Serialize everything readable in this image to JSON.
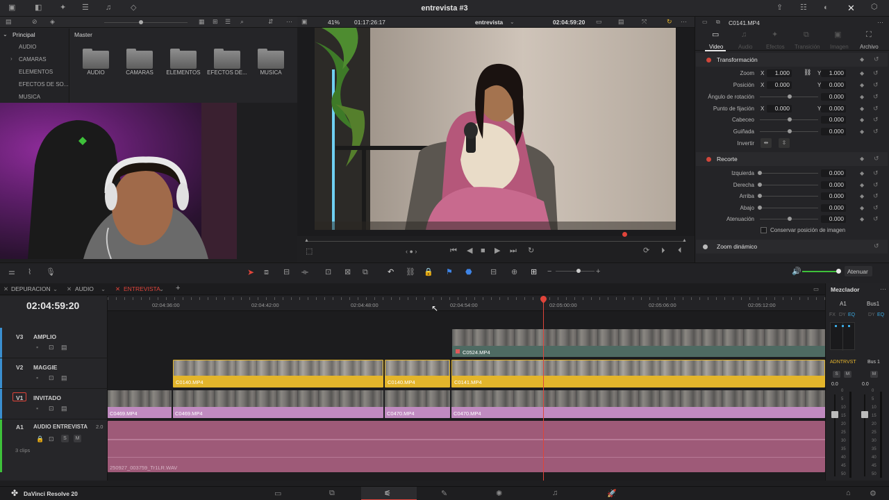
{
  "app": {
    "name": "DaVinci Resolve 20",
    "project_title": "entrevista #3"
  },
  "media_pool": {
    "principal_label": "Principal",
    "master_label": "Master",
    "bins": [
      "AUDIO",
      "CAMARAS",
      "ELEMENTOS",
      "EFECTOS DE SO...",
      "MUSICA"
    ],
    "folders": [
      "AUDIO",
      "CAMARAS",
      "ELEMENTOS",
      "EFECTOS DE...",
      "MUSICA"
    ]
  },
  "viewer": {
    "zoom": "41%",
    "source_timecode": "01:17:26:17",
    "timeline_name": "entrevista",
    "current_timecode": "02:04:59:20"
  },
  "inspector": {
    "clip_name": "C0141.MP4",
    "tabs": [
      "Video",
      "Audio",
      "Efectos",
      "Transición",
      "Imagen",
      "Archivo"
    ],
    "active_tab": "Video",
    "transform_title": "Transformación",
    "zoom_label": "Zoom",
    "zoom_x": "1.000",
    "zoom_y": "1.000",
    "position_label": "Posición",
    "position_x": "0.000",
    "position_y": "0.000",
    "rotation_label": "Ángulo de rotación",
    "rotation": "0.000",
    "anchor_label": "Punto de fijación",
    "anchor_x": "0.000",
    "anchor_y": "0.000",
    "pitch_label": "Cabeceo",
    "pitch": "0.000",
    "yaw_label": "Guiñada",
    "yaw": "0.000",
    "flip_label": "Invertir",
    "crop_title": "Recorte",
    "crop_left_label": "Izquierda",
    "crop_left": "0.000",
    "crop_right_label": "Derecha",
    "crop_right": "0.000",
    "crop_top_label": "Arriba",
    "crop_top": "0.000",
    "crop_bottom_label": "Abajo",
    "crop_bottom": "0.000",
    "softness_label": "Atenuación",
    "softness": "0.000",
    "retain_label": "Conservar posición de imagen",
    "dynamic_zoom_title": "Zoom dinámico",
    "x_label": "X",
    "y_label": "Y"
  },
  "toolbar": {
    "dim_label": "Atenuar"
  },
  "timeline": {
    "tabs": [
      "DEPURACION",
      "AUDIO",
      "ENTREVISTA"
    ],
    "active_tab": "ENTREVISTA",
    "timecode": "02:04:59:20",
    "ruler_labels": [
      "02:04:36:00",
      "02:04:42:00",
      "02:04:48:00",
      "02:04:54:00",
      "02:05:00:00",
      "02:05:06:00",
      "02:05:12:00"
    ],
    "tracks": {
      "v3": {
        "id": "V3",
        "name": "AMPLIO"
      },
      "v2": {
        "id": "V2",
        "name": "MAGGIE"
      },
      "v1": {
        "id": "V1",
        "name": "INVITADO"
      },
      "a1": {
        "id": "A1",
        "name": "AUDIO ENTREVISTA",
        "level": "2.0",
        "clip_count": "3 clips"
      }
    },
    "clips": {
      "v3_1": "C0524.MP4",
      "v2_1": "C0140.MP4",
      "v2_2": "C0140.MP4",
      "v2_3": "C0141.MP4",
      "v1_1": "C0469.MP4",
      "v1_2": "C0469.MP4",
      "v1_3": "C0470.MP4",
      "v1_4": "C0470.MP4",
      "a1_1": "250927_003759_Tr1LR.WAV"
    }
  },
  "mixer": {
    "title": "Mezclador",
    "ch1": "A1",
    "ch2": "Bus1",
    "ch1_name": "ADNTRVST",
    "ch2_name": "Bus 1",
    "ch1_level": "0.0",
    "ch2_level": "0.0",
    "fx": "FX",
    "dy": "DY",
    "eq": "EQ",
    "scale": [
      "0",
      "5",
      "10",
      "15",
      "20",
      "25",
      "30",
      "35",
      "40",
      "45",
      "50"
    ]
  },
  "colors": {
    "accent_red": "#e0443a",
    "clip_yellow": "#e3b52b",
    "clip_purple": "#c08ac0",
    "audio_pink": "#9e5a78",
    "playhead": "#e0443a"
  }
}
